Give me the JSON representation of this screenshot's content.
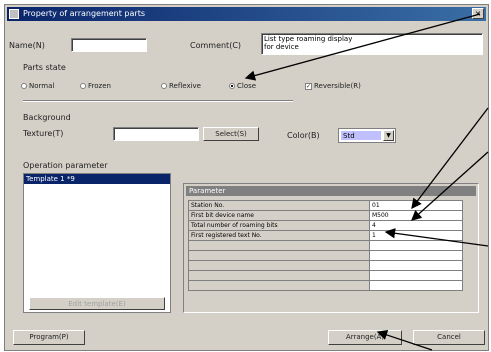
{
  "dialog": {
    "title": "Property of arrangement parts",
    "close_glyph": "×"
  },
  "name": {
    "label": "Name(N)",
    "value": ""
  },
  "comment": {
    "label": "Comment(C)",
    "value_line1": "List type roaming display",
    "value_line2": "for device"
  },
  "parts_state": {
    "label": "Parts state",
    "options": [
      "Normal",
      "Frozen",
      "Reflexive",
      "Close"
    ],
    "selected": "Close",
    "checkbox_label": "Reversible(R)",
    "checkbox_checked": true
  },
  "background": {
    "label": "Background",
    "texture_label": "Texture(T)",
    "texture_value": "",
    "select_button": "Select(S)",
    "color_label": "Color(B)",
    "color_value": "Std"
  },
  "operation": {
    "label": "Operation parameter",
    "list_items": [
      "Template 1 *9"
    ],
    "list_button": "Edit template(E)",
    "param_header": "Parameter",
    "params": [
      {
        "key": "Station No.",
        "value": "01"
      },
      {
        "key": "First bit device name",
        "value": "M500"
      },
      {
        "key": "Total number of roaming bits",
        "value": "4"
      },
      {
        "key": "First registered text No.",
        "value": "1"
      },
      {
        "key": "",
        "value": ""
      },
      {
        "key": "",
        "value": ""
      },
      {
        "key": "",
        "value": ""
      },
      {
        "key": "",
        "value": ""
      },
      {
        "key": "",
        "value": ""
      }
    ]
  },
  "footer": {
    "program_button": "Program(P)",
    "arrange_button": "Arrange(A)",
    "cancel_button": "Cancel"
  },
  "icons": {
    "title_icon": "window-icon",
    "checkmark": "✓",
    "dropdown": "▼"
  }
}
